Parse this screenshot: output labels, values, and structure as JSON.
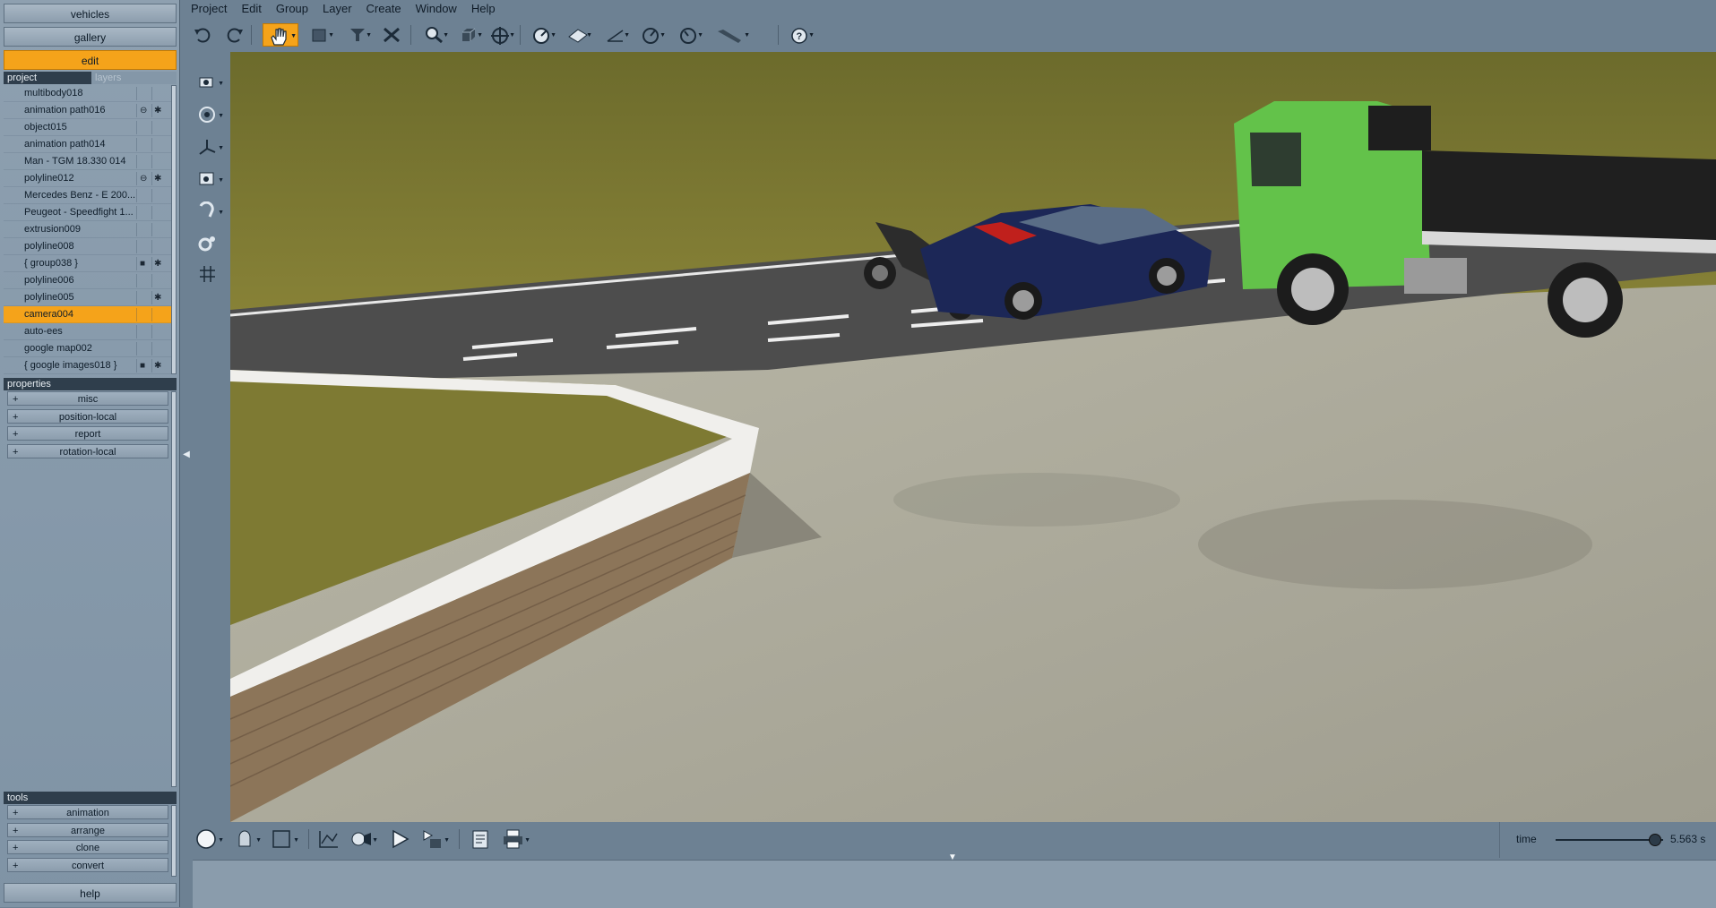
{
  "left_panel": {
    "top_buttons": {
      "vehicles": "vehicles",
      "gallery": "gallery",
      "edit": "edit"
    },
    "tabs": {
      "project": "project",
      "layers": "layers"
    },
    "project_items": [
      {
        "label": "multibody018",
        "selected": false,
        "icons": []
      },
      {
        "label": "animation path016",
        "selected": false,
        "icons": [
          "link-icon",
          "gear-icon"
        ]
      },
      {
        "label": "object015",
        "selected": false,
        "icons": []
      },
      {
        "label": "animation path014",
        "selected": false,
        "icons": []
      },
      {
        "label": "Man - TGM 18.330 014",
        "selected": false,
        "icons": []
      },
      {
        "label": "polyline012",
        "selected": false,
        "icons": [
          "link-icon",
          "gear-icon"
        ]
      },
      {
        "label": "Mercedes Benz - E 200...",
        "selected": false,
        "icons": []
      },
      {
        "label": "Peugeot - Speedfight 1...",
        "selected": false,
        "icons": []
      },
      {
        "label": "extrusion009",
        "selected": false,
        "icons": []
      },
      {
        "label": "polyline008",
        "selected": false,
        "icons": []
      },
      {
        "label": "{ group038 }",
        "selected": false,
        "icons": [
          "folder-icon",
          "gear-icon"
        ]
      },
      {
        "label": "polyline006",
        "selected": false,
        "icons": []
      },
      {
        "label": "polyline005",
        "selected": false,
        "icons": [
          "gear-icon"
        ]
      },
      {
        "label": "camera004",
        "selected": true,
        "icons": []
      },
      {
        "label": "auto-ees",
        "selected": false,
        "icons": []
      },
      {
        "label": "google map002",
        "selected": false,
        "icons": []
      },
      {
        "label": "{ google images018 }",
        "selected": false,
        "icons": [
          "folder-icon",
          "gear-icon"
        ]
      }
    ],
    "properties_header": "properties",
    "properties": [
      "misc",
      "position-local",
      "report",
      "rotation-local"
    ],
    "tools_header": "tools",
    "tools": [
      "animation",
      "arrange",
      "clone",
      "convert"
    ],
    "help": "help",
    "plus": "+"
  },
  "menu": [
    "Project",
    "Edit",
    "Group",
    "Layer",
    "Create",
    "Window",
    "Help"
  ],
  "toolbar": {
    "icons": [
      "undo-icon",
      "redo-icon",
      "pan-hand-icon",
      "select-rectangle-icon",
      "select-tool-icon",
      "delete-icon",
      "zoom-icon",
      "view-cube-icon",
      "orbit-icon",
      "measure-icon",
      "surface-icon",
      "dimension-icon",
      "angle-icon",
      "gauge-icon",
      "ruler-icon",
      "help-icon"
    ],
    "active": "pan-hand-icon"
  },
  "time": {
    "label": "time",
    "value": "5.563 s",
    "position_fraction": 0.92
  },
  "colors": {
    "accent": "#f5a31a",
    "panel": "#8a9cac",
    "header": "#2f3e4c"
  }
}
